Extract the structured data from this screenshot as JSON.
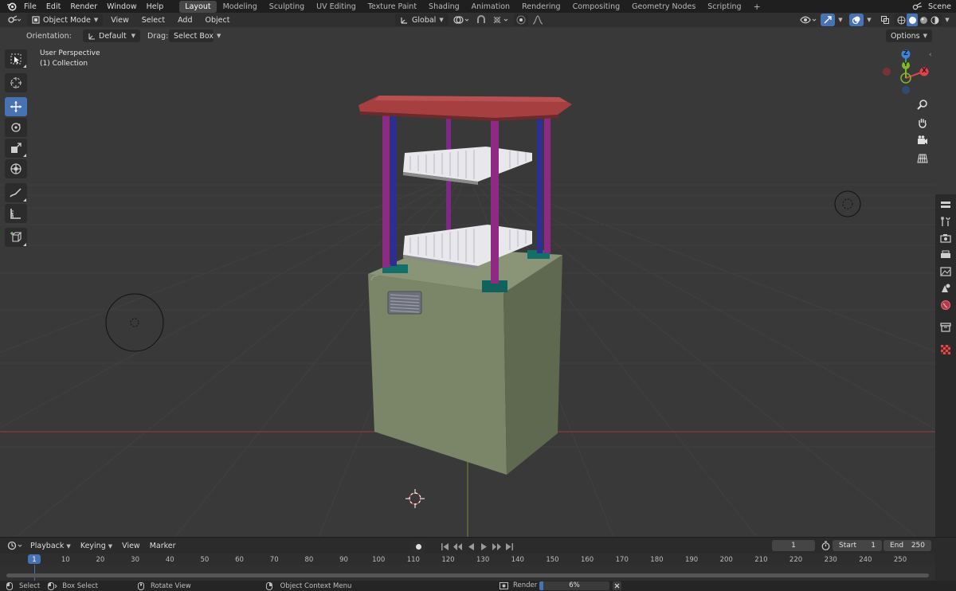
{
  "topbar": {
    "menus": [
      "File",
      "Edit",
      "Render",
      "Window",
      "Help"
    ],
    "workspaces": [
      "Layout",
      "Modeling",
      "Sculpting",
      "UV Editing",
      "Texture Paint",
      "Shading",
      "Animation",
      "Rendering",
      "Compositing",
      "Geometry Nodes",
      "Scripting"
    ],
    "active_workspace": "Layout",
    "add_tab": "+",
    "scene_label": "Scene"
  },
  "header": {
    "mode": "Object Mode",
    "menus": [
      "View",
      "Select",
      "Add",
      "Object"
    ],
    "transform_orientation": "Global"
  },
  "tool_settings": {
    "orientation_label": "Orientation:",
    "orientation_value": "Default",
    "drag_label": "Drag:",
    "drag_value": "Select Box",
    "options_label": "Options"
  },
  "viewport": {
    "perspective_label": "User Perspective",
    "collection_label": "(1) Collection",
    "gizmo": {
      "z": "Z",
      "y": "Y",
      "x": "X"
    }
  },
  "timeline": {
    "menus": [
      "Playback",
      "Keying",
      "View",
      "Marker"
    ],
    "current_frame": "1",
    "start_label": "Start",
    "start_value": "1",
    "end_label": "End",
    "end_value": "250",
    "ruler_ticks": [
      "1",
      "10",
      "20",
      "30",
      "40",
      "50",
      "60",
      "70",
      "80",
      "90",
      "100",
      "110",
      "120",
      "130",
      "140",
      "150",
      "160",
      "170",
      "180",
      "190",
      "200",
      "210",
      "220",
      "230",
      "240",
      "250"
    ],
    "ruler_frames": [
      1,
      10,
      20,
      30,
      40,
      50,
      60,
      70,
      80,
      90,
      100,
      110,
      120,
      130,
      140,
      150,
      160,
      170,
      180,
      190,
      200,
      210,
      220,
      230,
      240,
      250
    ]
  },
  "statusbar": {
    "select": "Select",
    "box_select": "Box Select",
    "rotate_view": "Rotate View",
    "context_menu": "Object Context Menu",
    "render_label": "Render",
    "render_progress_text": "6%",
    "render_progress": 0.06
  },
  "colors": {
    "accent": "#4772b3",
    "x_axis": "#e2434b",
    "y_axis": "#7fb929",
    "z_axis": "#3c86d8",
    "roof": "#a03a3a",
    "body": "#7a8466",
    "pillar_purple": "#8e2a84",
    "pillar_blue": "#2d2f8f",
    "feet": "#1b7f76"
  }
}
